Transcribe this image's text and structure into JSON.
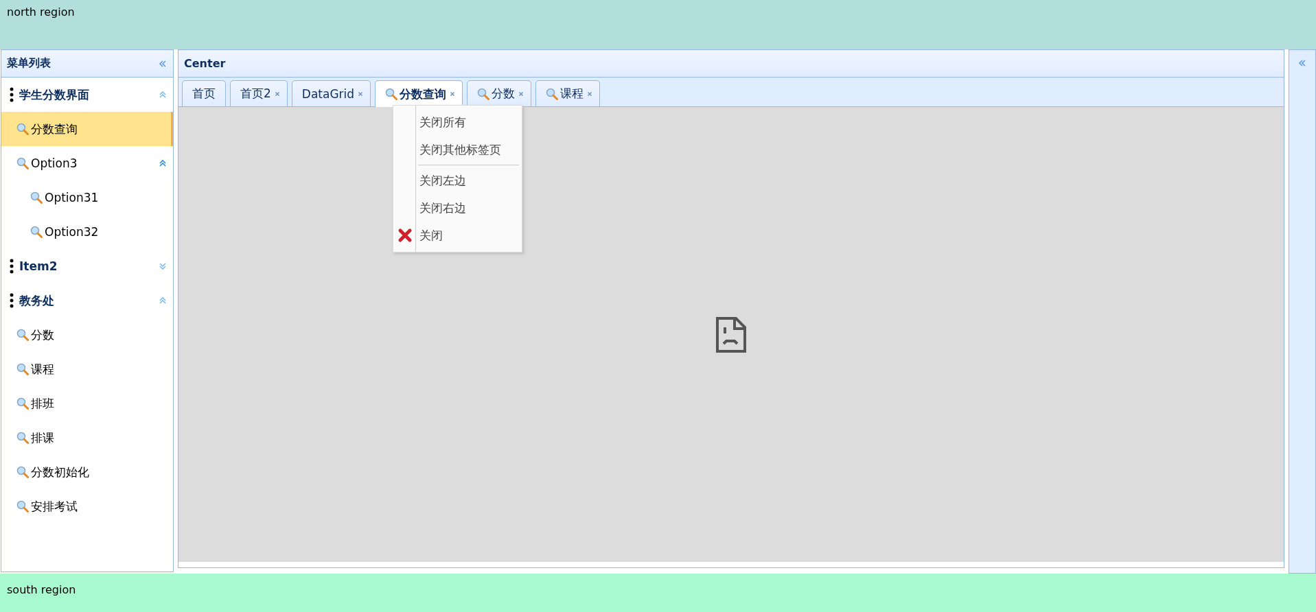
{
  "north": {
    "text": "north region"
  },
  "sidebar": {
    "title": "菜单列表",
    "items": [
      {
        "label": "学生分数界面",
        "expanded": true,
        "children": [
          {
            "label": "分数查询",
            "selected": true
          },
          {
            "label": "Option3",
            "selected": false,
            "expanded": true,
            "children": [
              {
                "label": "Option31",
                "selected": false
              },
              {
                "label": "Option32",
                "selected": false
              }
            ]
          }
        ]
      },
      {
        "label": "Item2",
        "expanded": false
      },
      {
        "label": "教务处",
        "expanded": true,
        "children": [
          {
            "label": "分数",
            "selected": false
          },
          {
            "label": "课程",
            "selected": false
          },
          {
            "label": "排班",
            "selected": false
          },
          {
            "label": "排课",
            "selected": false
          },
          {
            "label": "分数初始化",
            "selected": false
          },
          {
            "label": "安排考试",
            "selected": false
          }
        ]
      }
    ]
  },
  "center": {
    "title": "Center",
    "tabs": [
      {
        "label": "首页",
        "kind": "plain",
        "closable": false,
        "selected": false
      },
      {
        "label": "首页2",
        "kind": "plain",
        "closable": true,
        "selected": false
      },
      {
        "label": "DataGrid",
        "kind": "plain",
        "closable": true,
        "selected": false
      },
      {
        "label": "分数查询",
        "kind": "search",
        "closable": true,
        "selected": true
      },
      {
        "label": "分数",
        "kind": "search",
        "closable": true,
        "selected": false
      },
      {
        "label": "课程",
        "kind": "search",
        "closable": true,
        "selected": false
      }
    ]
  },
  "context_menu": {
    "items": [
      {
        "label": "关闭所有",
        "separator_before": false,
        "kind": "plain"
      },
      {
        "label": "关闭其他标签页",
        "separator_before": false,
        "kind": "plain"
      },
      {
        "label": "关闭左边",
        "separator_before": true,
        "kind": "plain"
      },
      {
        "label": "关闭右边",
        "separator_before": false,
        "kind": "plain"
      },
      {
        "label": "关闭",
        "separator_before": false,
        "kind": "cross"
      }
    ]
  },
  "south": {
    "text": "south region"
  }
}
